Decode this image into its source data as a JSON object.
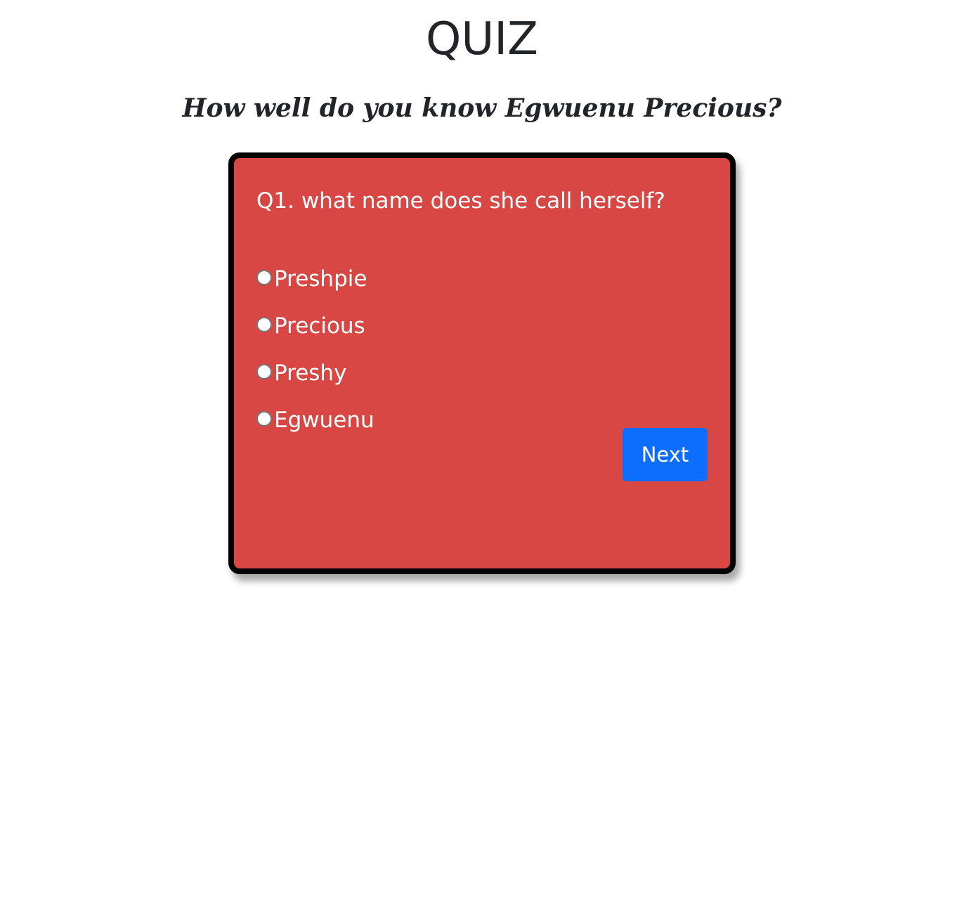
{
  "header": {
    "title": "QUIZ",
    "subtitle": "How well do you know Egwuenu Precious?"
  },
  "quiz": {
    "question": "Q1. what name does she call herself?",
    "options": [
      {
        "label": "Preshpie",
        "selected": false
      },
      {
        "label": "Precious",
        "selected": false
      },
      {
        "label": "Preshy",
        "selected": false
      },
      {
        "label": "Egwuenu",
        "selected": false
      }
    ],
    "next_label": "Next"
  },
  "colors": {
    "card_background": "#d94744",
    "card_border": "#000000",
    "button_background": "#0d6efd",
    "text_light": "#ffffff",
    "text_dark": "#212529"
  }
}
